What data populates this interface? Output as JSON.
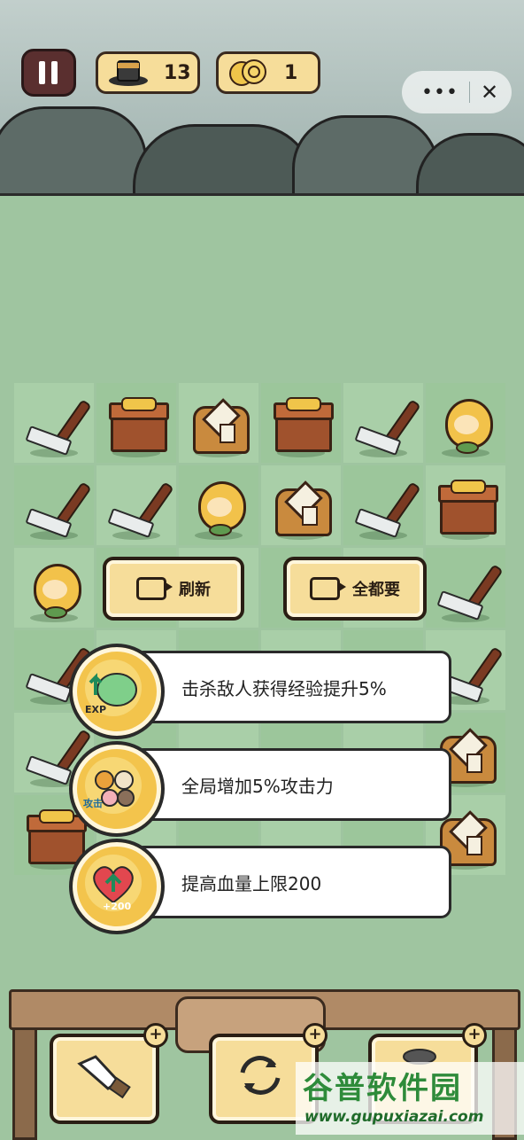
{
  "hud": {
    "hat_count": "13",
    "coin_count": "1"
  },
  "grid": {
    "rows": [
      [
        "rake",
        "box",
        "robe",
        "box",
        "rake",
        "peach"
      ],
      [
        "rake",
        "rake",
        "peach",
        "robe",
        "rake",
        "box"
      ],
      [
        "peach",
        "",
        "",
        "",
        "",
        "rake"
      ],
      [
        "rake",
        "",
        "",
        "",
        "",
        "rake"
      ],
      [
        "rake",
        "",
        "",
        "",
        "",
        "robe"
      ],
      [
        "box",
        "",
        "",
        "",
        "",
        "robe"
      ]
    ]
  },
  "buttons": {
    "refresh_label": "刷新",
    "take_all_label": "全都要"
  },
  "skills": [
    {
      "text": "击杀敌人获得经验提升5%",
      "badge": "EXP"
    },
    {
      "text": "全局增加5%攻击力",
      "badge": "攻击"
    },
    {
      "text": "提高血量上限200",
      "badge": "+200"
    }
  ],
  "colors": {
    "board_bg": "#9fc5a0",
    "button_fill": "#f6dd9a",
    "medal_fill": "#f3c44c"
  },
  "watermark": {
    "name": "谷普软件园",
    "url": "www.gupuxiazai.com"
  }
}
